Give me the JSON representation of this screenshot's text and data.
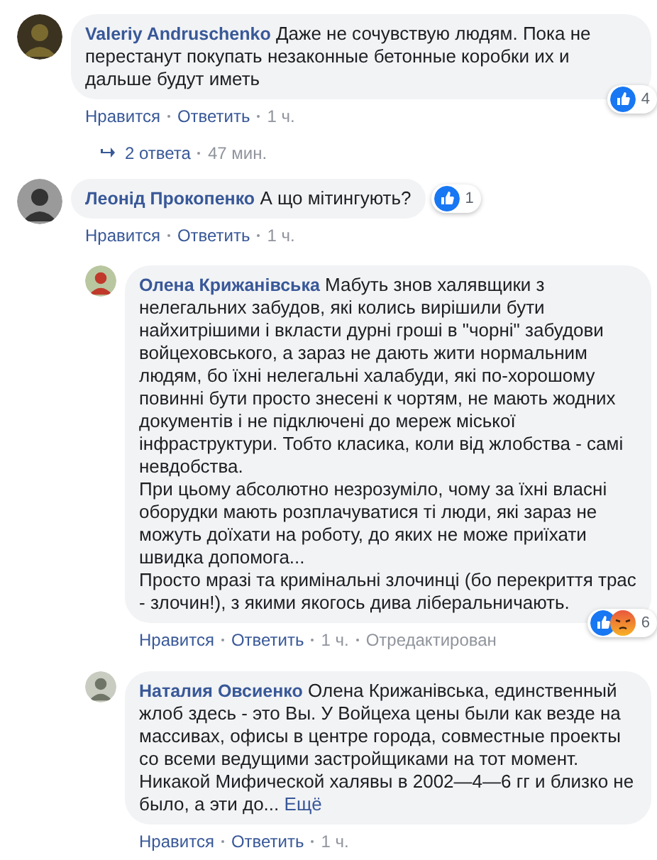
{
  "comments": [
    {
      "author": "Valeriy Andruschenko",
      "text": "Даже не сочувствую людям. Пока не перестанут покупать незаконные бетонные коробки их и дальше будут иметь",
      "actions": [
        "Нравится",
        "Ответить",
        "1 ч."
      ],
      "reactions": {
        "icons": [
          {
            "kind": "like"
          }
        ],
        "count": "4"
      },
      "replies_link": {
        "label": "2 ответа",
        "time": "47 мин."
      }
    },
    {
      "author": "Леонід Прокопенко",
      "text": "А що мітингують?",
      "actions": [
        "Нравится",
        "Ответить",
        "1 ч."
      ],
      "reactions": {
        "icons": [
          {
            "kind": "like"
          }
        ],
        "count": "1"
      },
      "children": [
        {
          "author": "Олена Крижанівська",
          "text": "Мабуть знов халявщики з нелегальних забудов, які колись вирішили бути найхитрішими і вкласти дурні гроші в \"чорні\" забудови войцеховського, а зараз не дають жити нормальним людям, бо їхні нелегальні халабуди, які по-хорошому повинні бути просто знесені к чортям, не мають жодних документів і не підключені до мереж міської інфраструктури. Тобто класика, коли від жлобства - самі невдобства.\nПри цьому абсолютно незрозуміло, чому за їхні власні оборудки мають розплачуватися ті люди, які зараз не можуть доїхати на роботу, до яких не може приїхати швидка допомога...\nПросто мразі та кримінальні злочинці (бо перекриття трас - злочин!), з якими якогось дива ліберальничають.",
          "actions": [
            "Нравится",
            "Ответить",
            "1 ч.",
            "Отредактирован"
          ],
          "reactions": {
            "icons": [
              {
                "kind": "like"
              },
              {
                "kind": "angry"
              }
            ],
            "count": "6"
          }
        },
        {
          "author": "Наталия Овсиенко",
          "text": "Олена Крижанівська, единственный жлоб здесь - это Вы. У Войцеха цены были как везде на массивах, офисы в центре города, совместные проекты со всеми ведущими застройщиками на тот момент. Никакой Мифической халявы в 2002—4—6 гг и близко не было, а эти до...",
          "more": "Ещё",
          "actions": [
            "Нравится",
            "Ответить",
            "1 ч."
          ]
        }
      ]
    }
  ]
}
